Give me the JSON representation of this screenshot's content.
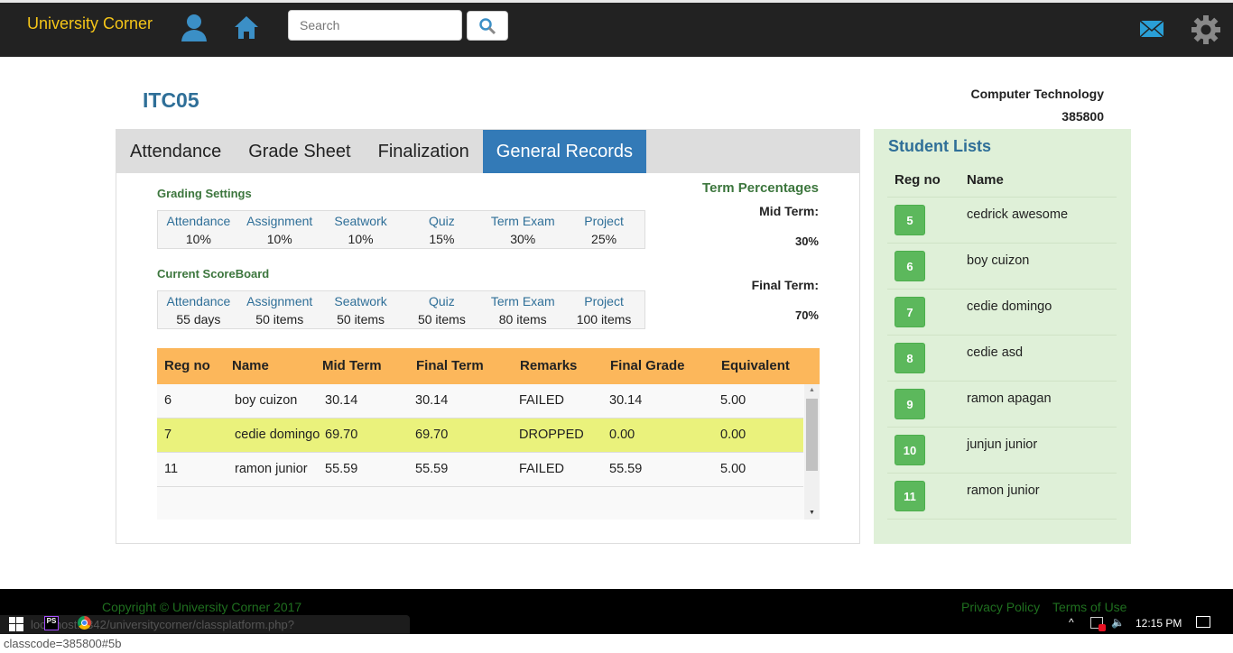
{
  "header": {
    "brand": "University Corner",
    "search_placeholder": "Search",
    "icons": [
      "user-icon",
      "home-icon",
      "search-icon",
      "mail-icon",
      "gear-icon"
    ]
  },
  "course": {
    "code": "ITC05",
    "department": "Computer Technology",
    "class_code": "385800"
  },
  "tabs": [
    {
      "label": "Attendance"
    },
    {
      "label": "Grade Sheet"
    },
    {
      "label": "Finalization"
    },
    {
      "label": "General Records",
      "active": true
    }
  ],
  "grading_settings": {
    "title": "Grading Settings",
    "items": [
      {
        "label": "Attendance",
        "value": "10%"
      },
      {
        "label": "Assignment",
        "value": "10%"
      },
      {
        "label": "Seatwork",
        "value": "10%"
      },
      {
        "label": "Quiz",
        "value": "15%"
      },
      {
        "label": "Term Exam",
        "value": "30%"
      },
      {
        "label": "Project",
        "value": "25%"
      }
    ]
  },
  "scoreboard": {
    "title": "Current ScoreBoard",
    "items": [
      {
        "label": "Attendance",
        "value": "55 days"
      },
      {
        "label": "Assignment",
        "value": "50 items"
      },
      {
        "label": "Seatwork",
        "value": "50 items"
      },
      {
        "label": "Quiz",
        "value": "50 items"
      },
      {
        "label": "Term Exam",
        "value": "80 items"
      },
      {
        "label": "Project",
        "value": "100 items"
      }
    ]
  },
  "term_percentages": {
    "title": "Term Percentages",
    "mid_label": "Mid Term:",
    "mid_value": "30%",
    "final_label": "Final Term:",
    "final_value": "70%"
  },
  "grades": {
    "columns": [
      "Reg no",
      "Name",
      "Mid Term",
      "Final Term",
      "Remarks",
      "Final Grade",
      "Equivalent"
    ],
    "rows": [
      [
        "6",
        "boy cuizon",
        "30.14",
        "30.14",
        "FAILED",
        "30.14",
        "5.00"
      ],
      [
        "7",
        "cedie domingo",
        "69.70",
        "69.70",
        "DROPPED",
        "0.00",
        "0.00"
      ],
      [
        "11",
        "ramon junior",
        "55.59",
        "55.59",
        "FAILED",
        "55.59",
        "5.00"
      ]
    ]
  },
  "highlight_color": "#eaf27c",
  "students": {
    "title": "Student Lists",
    "columns": [
      "Reg no",
      "Name"
    ],
    "rows": [
      [
        "5",
        "cedrick awesome"
      ],
      [
        "6",
        "boy cuizon"
      ],
      [
        "7",
        "cedie domingo"
      ],
      [
        "8",
        "cedie asd"
      ],
      [
        "9",
        "ramon apagan"
      ],
      [
        "10",
        "junjun junior"
      ],
      [
        "11",
        "ramon junior"
      ]
    ]
  },
  "footer": {
    "copyright": "Copyright © University Corner 2017",
    "privacy": "Privacy Policy",
    "terms": "Terms of Use"
  },
  "status_url": "localhost:8342/universitycorner/classplatform.php?classcode=385800#5b",
  "taskbar": {
    "clock": "12:15 PM"
  }
}
